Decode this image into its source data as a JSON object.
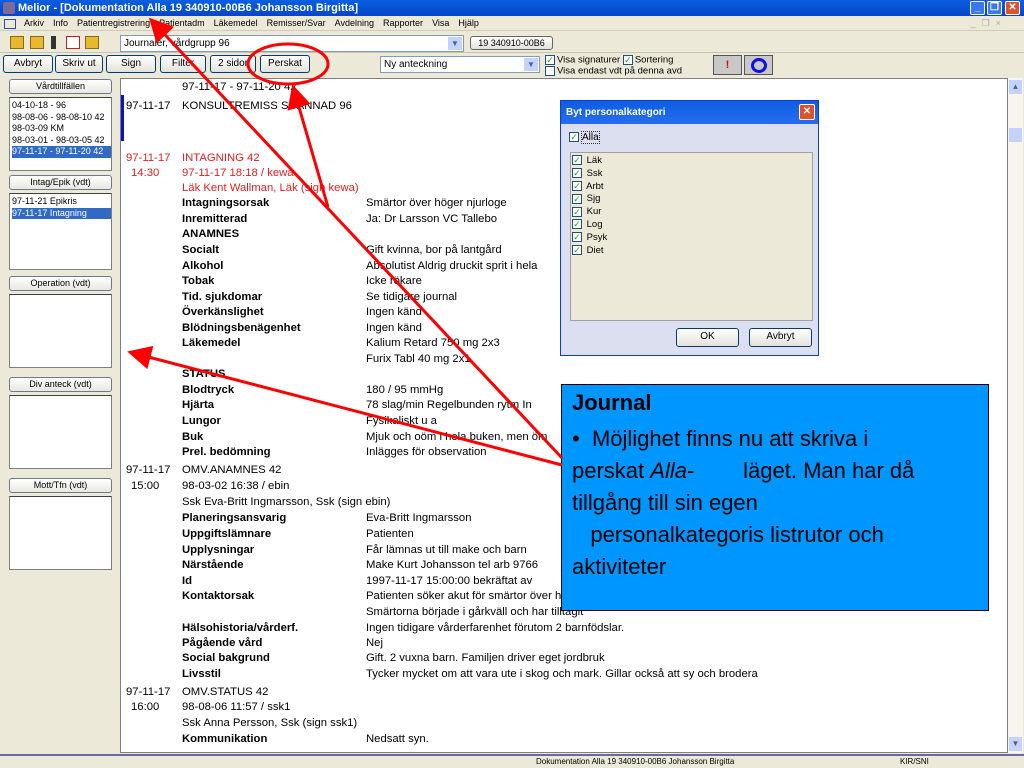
{
  "window": {
    "title": "Melior - [Dokumentation Alla 19 340910-00B6 Johansson Birgitta]"
  },
  "menu": [
    "Arkiv",
    "Info",
    "Patientregistrering",
    "Patientadm",
    "Läkemedel",
    "Remisser/Svar",
    "Avdelning",
    "Rapporter",
    "Visa",
    "Hjälp"
  ],
  "toolbar": {
    "journal_select": "Journaler, vårdgrupp 96",
    "patient_id": "19 340910-00B6"
  },
  "buttons": {
    "avbryt": "Avbryt",
    "skrivut": "Skriv ut",
    "sign": "Sign",
    "filter": "Filter",
    "tvasidor": "2 sidor",
    "perskat": "Perskat"
  },
  "note_type": "Ny anteckning",
  "options": {
    "visa_sign": "Visa signaturer",
    "sortering": "Sortering",
    "visa_endast": "Visa endast vdt på denna avd",
    "visa_sign_checked": true,
    "sortering_checked": true,
    "visa_endast_checked": false
  },
  "left": {
    "vardtillfallen_label": "Vårdtillfällen",
    "vardtillfallen": [
      "04-10-18 -        96",
      "98-08-06 - 98-08-10 42",
      "98-03-09          KM",
      "98-03-01 - 98-03-05 42",
      "97-11-17 - 97-11-20 42"
    ],
    "intag_label": "Intag/Epik (vdt)",
    "intag": [
      "97-11-21  Epikris",
      "97-11-17  Intagning"
    ],
    "operation_label": "Operation (vdt)",
    "divanteck_label": "Div anteck (vdt)",
    "mott_label": "Mott/Tfn (vdt)"
  },
  "journal": [
    {
      "t": "97-11-17 - 97-11-20  42"
    },
    {
      "d": "97-11-17",
      "t": "KONSULTREMISS SCANNAD    96"
    },
    {
      "d": "97-11-17",
      "t": "INTAGNING    42",
      "red": true
    },
    {
      "d": " 14:30",
      "t": "97-11-17 18:18 / kewa",
      "red": true
    },
    {
      "t": "Läk Kent Wallman, Läk (sign kewa)",
      "red": true
    },
    {
      "l": "Intagningsorsak",
      "v": "Smärtor över höger njurloge"
    },
    {
      "l": "Inremitterad",
      "v": "Ja: Dr Larsson VC Tallebo"
    },
    {
      "l": "ANAMNES"
    },
    {
      "l": "Socialt",
      "v": "Gift kvinna, bor på lantgård"
    },
    {
      "l": "Alkohol",
      "v": "Absolutist Aldrig druckit sprit i hela"
    },
    {
      "l": "Tobak",
      "v": "Icke rökare"
    },
    {
      "l": "Tid. sjukdomar",
      "v": "Se tidigare journal"
    },
    {
      "l": "Överkänslighet",
      "v": "Ingen känd"
    },
    {
      "l": "Blödningsbenägenhet",
      "v": "Ingen känd"
    },
    {
      "l": "Läkemedel",
      "v": "Kalium Retard 750 mg 2x3"
    },
    {
      "v": "Furix Tabl 40 mg 2x1"
    },
    {
      "l": "STATUS"
    },
    {
      "l": "Blodtryck",
      "v": "180  /  95  mmHg"
    },
    {
      "l": "Hjärta",
      "v": "78  slag/min   Regelbunden rytm  In"
    },
    {
      "l": "Lungor",
      "v": "Fysikaliskt u a"
    },
    {
      "l": "Buk",
      "v": "Mjuk och oöm i hela buken, men öm"
    },
    {
      "l": "Prel. bedömning",
      "v": "Inlägges för observation"
    },
    {
      "d": "97-11-17",
      "t": "OMV.ANAMNES    42"
    },
    {
      "d": " 15:00",
      "t": "98-03-02 16:38 / ebin"
    },
    {
      "t": "Ssk Eva-Britt Ingmarsson, Ssk (sign ebin)"
    },
    {
      "l": "Planeringsansvarig",
      "v": "Eva-Britt Ingmarsson"
    },
    {
      "l": "Uppgiftslämnare",
      "v": "Patienten"
    },
    {
      "l": "Upplysningar",
      "v": "Får lämnas ut till make och barn"
    },
    {
      "l": "Närstående",
      "v": "Make Kurt Johansson tel arb 9766"
    },
    {
      "l": "Id",
      "v": "1997-11-17 15:00:00 bekräftat av"
    },
    {
      "l": "Kontaktorsak",
      "v": "Patienten söker akut för smärtor över höger njurloge sedan igår kväll ...                                                                                           n."
    },
    {
      "v": "Smärtorna började i gårkväll och har tilltagit"
    },
    {
      "l": "Hälsohistoria/vårderf.",
      "v": "Ingen tidigare vårderfarenhet förutom 2 barnfödslar."
    },
    {
      "l": "Pågående vård",
      "v": "Nej"
    },
    {
      "l": "Social bakgrund",
      "v": "Gift. 2 vuxna barn. Familjen driver eget jordbruk"
    },
    {
      "l": "Livsstil",
      "v": "Tycker mycket om att vara ute i skog och mark. Gillar också att sy och brodera"
    },
    {
      "d": "97-11-17",
      "t": "OMV.STATUS    42"
    },
    {
      "d": " 16:00",
      "t": "98-08-06 11:57 / ssk1"
    },
    {
      "t": "Ssk Anna Persson, Ssk (sign ssk1)"
    },
    {
      "l": "Kommunikation",
      "v": "Nedsatt syn."
    }
  ],
  "dialog": {
    "title": "Byt personalkategori",
    "alla": "Alla",
    "categories": [
      "Läk",
      "Ssk",
      "Arbt",
      "Sjg",
      "Kur",
      "Log",
      "Psyk",
      "Diet"
    ],
    "ok": "OK",
    "avbryt": "Avbryt"
  },
  "callout": {
    "title": "Journal",
    "line1": "Möjlighet finns nu att skriva i",
    "line2a": "perskat ",
    "line2b": "Alla",
    "line2c": "-        läget. Man har då",
    "line3": "tillgång till sin egen",
    "line4": "personalkategoris listrutor och",
    "line5": "aktiviteter"
  },
  "statusbar": {
    "doc": "Dokumentation Alla 19 340910-00B6 Johansson Birgitta",
    "unit": "KIR/SNI"
  },
  "colors": {
    "annotation": "#ff0000",
    "callout": "#0096ff",
    "selection": "#316ac5"
  }
}
